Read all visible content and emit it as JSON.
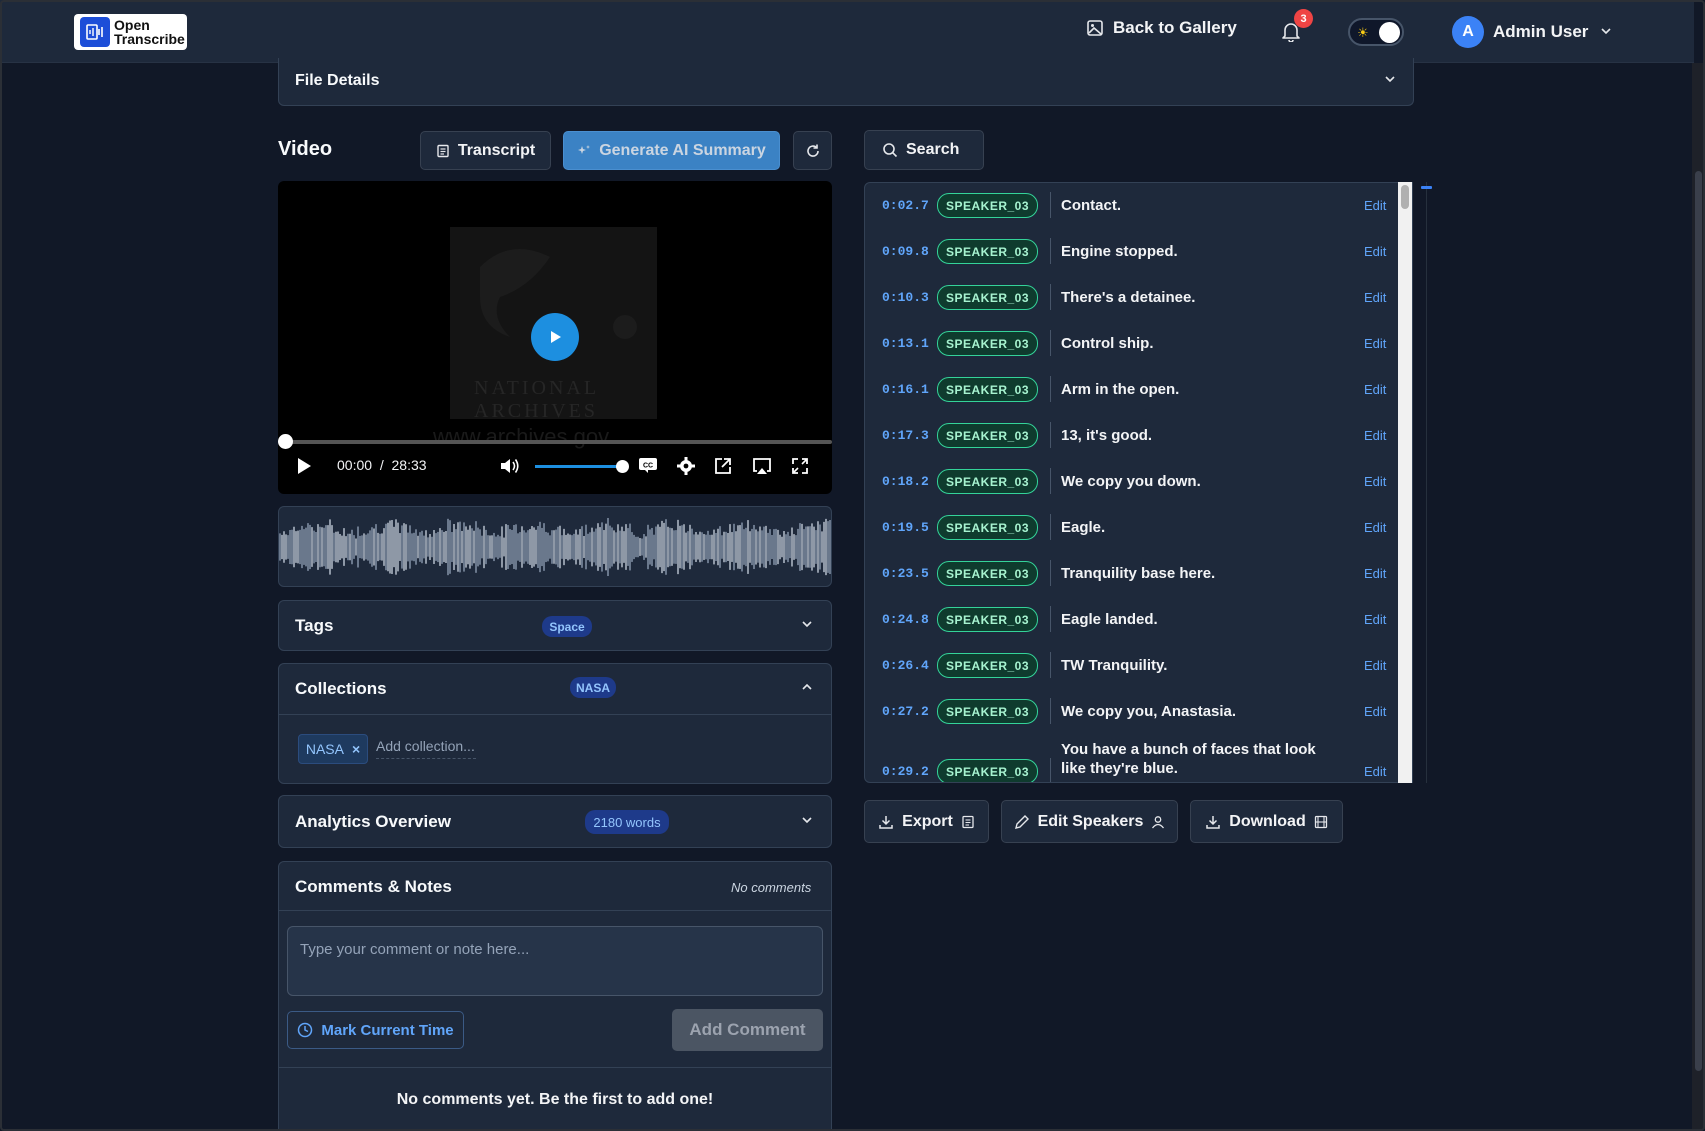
{
  "nav": {
    "logo_line1": "Open",
    "logo_line2": "Transcribe",
    "back_label": "Back to Gallery",
    "notification_count": "3",
    "user_initial": "A",
    "user_name": "Admin User"
  },
  "file_details": {
    "title": "File Details"
  },
  "video_section": {
    "title": "Video",
    "transcript_btn": "Transcript",
    "ai_summary_btn": "Generate AI Summary",
    "current_time": "00:00",
    "separator": "/",
    "duration": "28:33",
    "poster_text": "NATIONAL ARCHIVES",
    "watermark": "www.archives.gov"
  },
  "tags": {
    "title": "Tags",
    "badge": "Space"
  },
  "collections": {
    "title": "Collections",
    "badge": "NASA",
    "chip": "NASA",
    "chip_remove": "×",
    "add_placeholder": "Add collection..."
  },
  "analytics": {
    "title": "Analytics Overview",
    "badge": "2180 words"
  },
  "comments": {
    "title": "Comments & Notes",
    "count_label": "No comments",
    "placeholder": "Type your comment or note here...",
    "mark_time_btn": "Mark Current Time",
    "add_btn": "Add Comment",
    "empty_text": "No comments yet. Be the first to add one!"
  },
  "search": {
    "label": "Search"
  },
  "transcript": {
    "edit_label": "Edit",
    "rows": [
      {
        "time": "0:02.7",
        "speaker": "SPEAKER_03",
        "text": "Contact."
      },
      {
        "time": "0:09.8",
        "speaker": "SPEAKER_03",
        "text": "Engine stopped."
      },
      {
        "time": "0:10.3",
        "speaker": "SPEAKER_03",
        "text": "There's a detainee."
      },
      {
        "time": "0:13.1",
        "speaker": "SPEAKER_03",
        "text": "Control ship."
      },
      {
        "time": "0:16.1",
        "speaker": "SPEAKER_03",
        "text": "Arm in the open."
      },
      {
        "time": "0:17.3",
        "speaker": "SPEAKER_03",
        "text": "13, it's good."
      },
      {
        "time": "0:18.2",
        "speaker": "SPEAKER_03",
        "text": "We copy you down."
      },
      {
        "time": "0:19.5",
        "speaker": "SPEAKER_03",
        "text": "Eagle."
      },
      {
        "time": "0:23.5",
        "speaker": "SPEAKER_03",
        "text": "Tranquility base here."
      },
      {
        "time": "0:24.8",
        "speaker": "SPEAKER_03",
        "text": "Eagle landed."
      },
      {
        "time": "0:26.4",
        "speaker": "SPEAKER_03",
        "text": "TW Tranquility."
      },
      {
        "time": "0:27.2",
        "speaker": "SPEAKER_03",
        "text": "We copy you, Anastasia."
      },
      {
        "time": "0:29.2",
        "speaker": "SPEAKER_03",
        "text": "You have a bunch of faces that look like they're blue."
      }
    ]
  },
  "actions": {
    "export": "Export",
    "edit_speakers": "Edit Speakers",
    "download": "Download"
  },
  "colors": {
    "accent": "#3b82f6",
    "speaker_badge": "#34d399",
    "background": "#111827",
    "panel": "#1e293b"
  }
}
